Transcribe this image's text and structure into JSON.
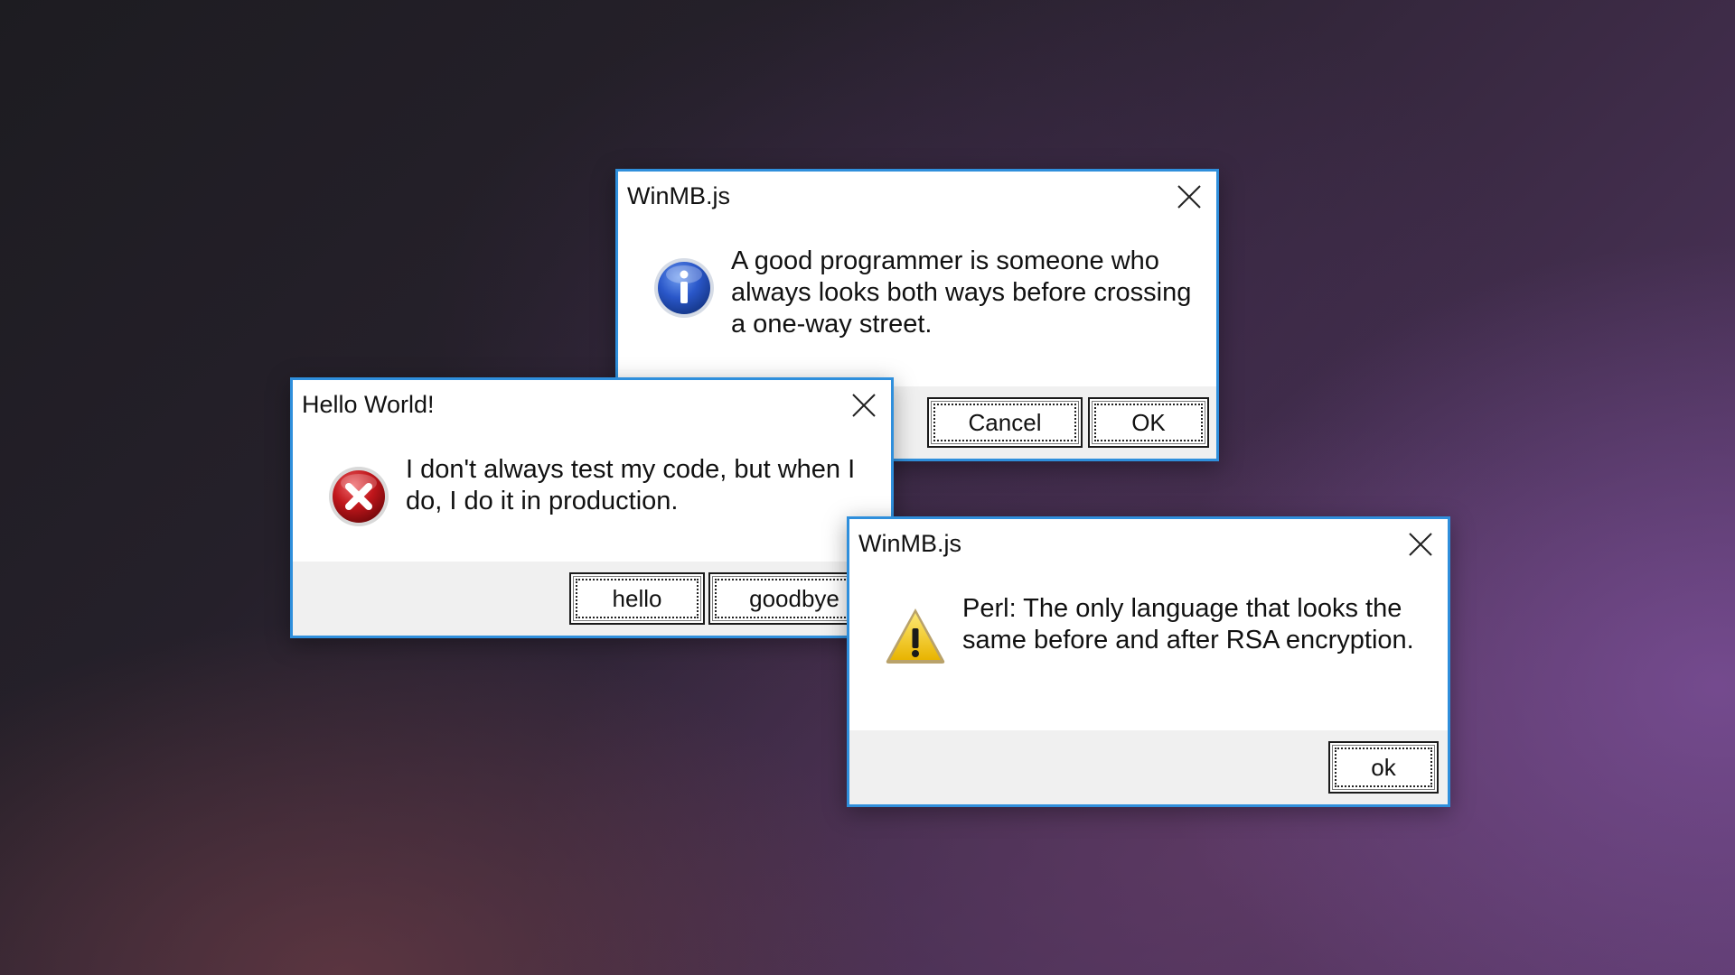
{
  "dialogs": {
    "info": {
      "title": "WinMB.js",
      "message": "A good programmer is someone who always looks both ways before crossing a one-way street.",
      "icon": "info-icon",
      "buttons": [
        "Cancel",
        "OK"
      ]
    },
    "error": {
      "title": "Hello World!",
      "message": "I don't always test my code, but when I do, I do it in production.",
      "icon": "error-icon",
      "buttons": [
        "hello",
        "goodbye"
      ]
    },
    "warning": {
      "title": "WinMB.js",
      "message": "Perl: The only language that looks the same before and after RSA encryption.",
      "icon": "warning-icon",
      "buttons": [
        "ok"
      ]
    }
  },
  "colors": {
    "dialog_border": "#2f8fdc",
    "footer_bg": "#f0f0f0",
    "info_blue": "#2a57c9",
    "error_red": "#c0161b",
    "warning_yellow": "#f3cf1a"
  }
}
